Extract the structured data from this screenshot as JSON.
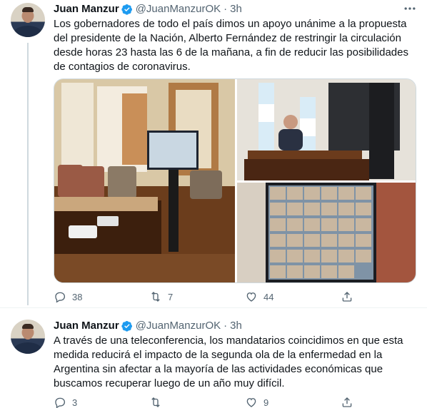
{
  "tweets": [
    {
      "author": "Juan Manzur",
      "handle": "@JuanManzurOK",
      "separator": "·",
      "time": "3h",
      "text": "Los gobernadores de todo el país dimos un apoyo unánime a la propuesta del presidente de la Nación, Alberto Fernández de restringir la circulación desde horas 23 hasta las 6 de la mañana, a fin de reducir las posibilidades de contagios de coronavirus.",
      "stats": {
        "replies": "38",
        "retweets": "7",
        "likes": "44"
      }
    },
    {
      "author": "Juan Manzur",
      "handle": "@JuanManzurOK",
      "separator": "·",
      "time": "3h",
      "text": "A través de una teleconferencia, los mandatarios coincidimos en que esta medida reducirá el impacto de la segunda ola de la enfermedad en la Argentina sin afectar a la mayoría de las actividades económicas que buscamos recuperar luego de un año muy difícil.",
      "stats": {
        "replies": "3",
        "retweets": "",
        "likes": "9"
      }
    }
  ],
  "colors": {
    "verified": "#1d9bf0",
    "secondary_text": "#536471",
    "thread_line": "#cfd9de"
  },
  "icons": [
    "verified-badge-icon",
    "more-options-icon",
    "reply-icon",
    "retweet-icon",
    "like-icon",
    "share-icon"
  ]
}
